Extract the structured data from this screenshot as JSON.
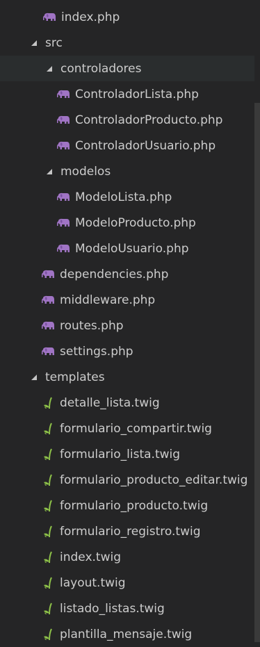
{
  "colors": {
    "background": "#252526",
    "text": "#cccccc",
    "php_icon": "#a074c4",
    "twig_icon": "#8dc149"
  },
  "tree": [
    {
      "label": "index.php",
      "type": "file",
      "icon": "php-elephant-icon",
      "depth": 1
    },
    {
      "label": "src",
      "type": "folder",
      "expanded": true,
      "depth": 1
    },
    {
      "label": "controladores",
      "type": "folder",
      "expanded": true,
      "depth": 2,
      "selected": true
    },
    {
      "label": "ControladorLista.php",
      "type": "file",
      "icon": "php-elephant-icon",
      "depth": 3
    },
    {
      "label": "ControladorProducto.php",
      "type": "file",
      "icon": "php-elephant-icon",
      "depth": 3
    },
    {
      "label": "ControladorUsuario.php",
      "type": "file",
      "icon": "php-elephant-icon",
      "depth": 3
    },
    {
      "label": "modelos",
      "type": "folder",
      "expanded": true,
      "depth": 2
    },
    {
      "label": "ModeloLista.php",
      "type": "file",
      "icon": "php-elephant-icon",
      "depth": 3
    },
    {
      "label": "ModeloProducto.php",
      "type": "file",
      "icon": "php-elephant-icon",
      "depth": 3
    },
    {
      "label": "ModeloUsuario.php",
      "type": "file",
      "icon": "php-elephant-icon",
      "depth": 3
    },
    {
      "label": "dependencies.php",
      "type": "file",
      "icon": "php-elephant-icon",
      "depth": 2
    },
    {
      "label": "middleware.php",
      "type": "file",
      "icon": "php-elephant-icon",
      "depth": 2
    },
    {
      "label": "routes.php",
      "type": "file",
      "icon": "php-elephant-icon",
      "depth": 2
    },
    {
      "label": "settings.php",
      "type": "file",
      "icon": "php-elephant-icon",
      "depth": 2
    },
    {
      "label": "templates",
      "type": "folder",
      "expanded": true,
      "depth": 1
    },
    {
      "label": "detalle_lista.twig",
      "type": "file",
      "icon": "twig-icon",
      "depth": 2
    },
    {
      "label": "formulario_compartir.twig",
      "type": "file",
      "icon": "twig-icon",
      "depth": 2
    },
    {
      "label": "formulario_lista.twig",
      "type": "file",
      "icon": "twig-icon",
      "depth": 2
    },
    {
      "label": "formulario_producto_editar.twig",
      "type": "file",
      "icon": "twig-icon",
      "depth": 2
    },
    {
      "label": "formulario_producto.twig",
      "type": "file",
      "icon": "twig-icon",
      "depth": 2
    },
    {
      "label": "formulario_registro.twig",
      "type": "file",
      "icon": "twig-icon",
      "depth": 2
    },
    {
      "label": "index.twig",
      "type": "file",
      "icon": "twig-icon",
      "depth": 2
    },
    {
      "label": "layout.twig",
      "type": "file",
      "icon": "twig-icon",
      "depth": 2
    },
    {
      "label": "listado_listas.twig",
      "type": "file",
      "icon": "twig-icon",
      "depth": 2
    },
    {
      "label": "plantilla_mensaje.twig",
      "type": "file",
      "icon": "twig-icon",
      "depth": 2
    }
  ]
}
